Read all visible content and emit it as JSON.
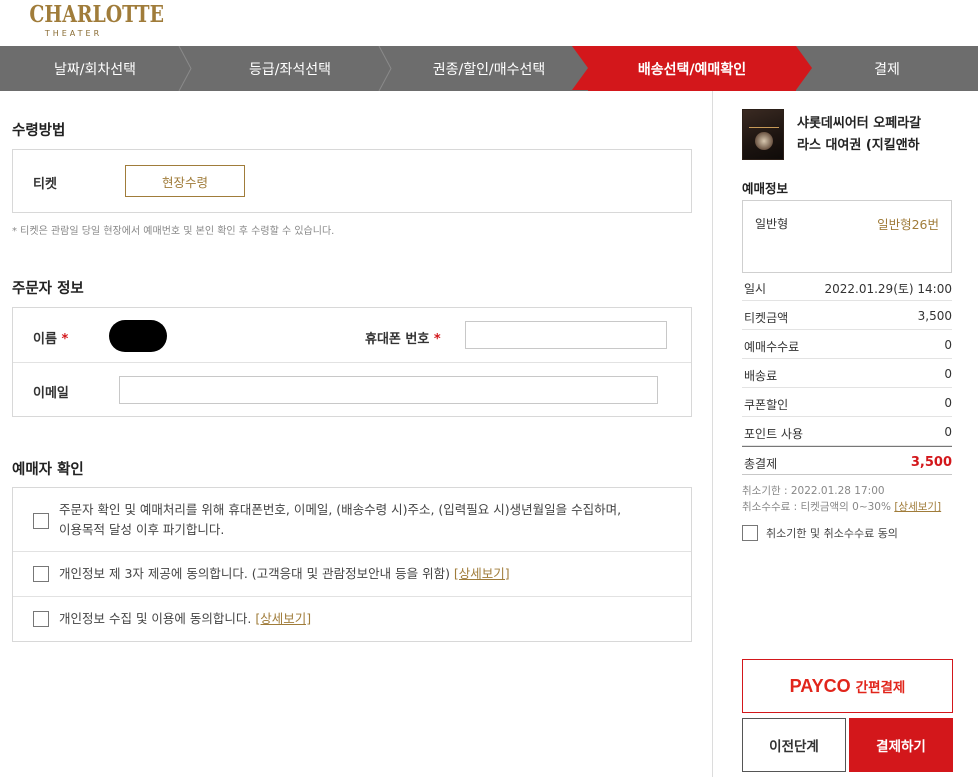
{
  "logo": {
    "main": "CHARLOTTE",
    "sub": "THEATER"
  },
  "steps": [
    {
      "label": "날짜/회차선택",
      "active": false
    },
    {
      "label": "등급/좌석선택",
      "active": false
    },
    {
      "label": "권종/할인/매수선택",
      "active": false
    },
    {
      "label": "배송선택/예매확인",
      "active": true
    },
    {
      "label": "결제",
      "active": false
    }
  ],
  "delivery": {
    "title": "수령방법",
    "ticket_label": "티켓",
    "onsite_button": "현장수령",
    "note": "* 티켓은 관람일 당일 현장에서 예매번호 및 본인 확인 후 수령할 수 있습니다."
  },
  "orderer": {
    "title": "주문자 정보",
    "name_label": "이름",
    "phone_label": "휴대폰 번호",
    "email_label": "이메일",
    "required_mark": "*",
    "phone_value": "",
    "email_value": ""
  },
  "confirm": {
    "title": "예매자 확인",
    "items": [
      {
        "text_line1": "주문자 확인 및 예매처리를 위해 휴대폰번호, 이메일, (배송수령 시)주소, (입력필요 시)생년월일을 수집하며,",
        "text_line2": "이용목적 달성 이후 파기합니다.",
        "link": ""
      },
      {
        "text_line1": "개인정보 제 3자 제공에 동의합니다. (고객응대 및 관람정보안내 등을 위함) ",
        "text_line2": "",
        "link": "[상세보기]"
      },
      {
        "text_line1": "개인정보 수집 및 이용에 동의합니다. ",
        "text_line2": "",
        "link": "[상세보기]"
      }
    ]
  },
  "summary": {
    "show_title_line1": "샤롯데씨어터 오페라갈",
    "show_title_line2": "라스 대여권 (지킬앤하",
    "booking_info_title": "예매정보",
    "seat_label": "일반형",
    "seat_value": "일반형26번",
    "rows": [
      {
        "label": "일시",
        "value": "2022.01.29(토) 14:00"
      },
      {
        "label": "티켓금액",
        "value": "3,500"
      },
      {
        "label": "예매수수료",
        "value": "0"
      },
      {
        "label": "배송료",
        "value": "0"
      },
      {
        "label": "쿠폰할인",
        "value": "0"
      },
      {
        "label": "포인트 사용",
        "value": "0"
      }
    ],
    "total_label": "총결제",
    "total_value": "3,500",
    "cancel_deadline": "취소기한 : 2022.01.28 17:00",
    "cancel_fee": "취소수수료 : 티켓금액의 0~30% ",
    "cancel_fee_link": "[상세보기]",
    "cancel_agree": "취소기한 및 취소수수료 동의",
    "payco_brand": "PAYCO",
    "payco_label": "간편결제",
    "prev_button": "이전단계",
    "pay_button": "결제하기"
  },
  "colors": {
    "accent_red": "#d3171b",
    "gold": "#a07c3a",
    "step_gray": "#6d6d6d"
  }
}
